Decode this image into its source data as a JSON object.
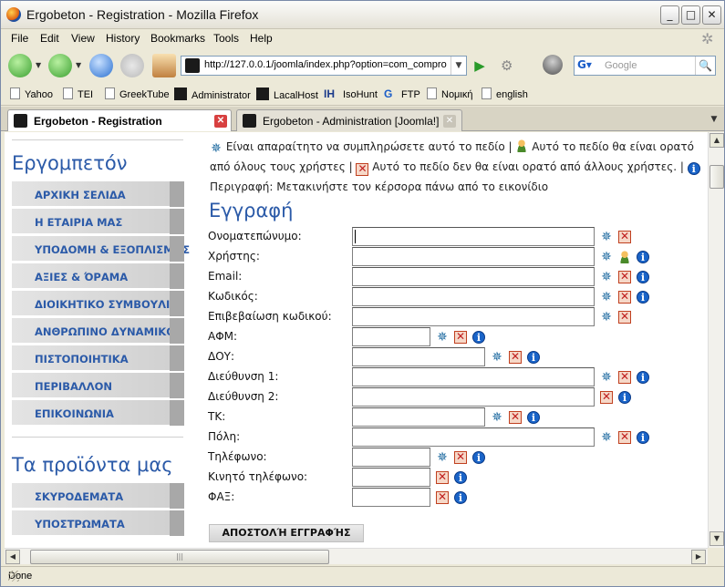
{
  "window": {
    "title": "Ergobeton - Registration - Mozilla Firefox",
    "buttons": {
      "minimize": "_",
      "maximize": "□",
      "close": "✕"
    }
  },
  "menu": [
    "File",
    "Edit",
    "View",
    "History",
    "Bookmarks",
    "Tools",
    "Help"
  ],
  "nav": {
    "url": "http://127.0.0.1/joomla/index.php?option=com_compro",
    "search_placeholder": "Google"
  },
  "bookmarks": [
    "Yahoo",
    "TEI",
    "GreekTube",
    "Administrator",
    "LacalHost",
    "IsoHunt",
    "FTP",
    "Νομική",
    "english"
  ],
  "tabs": [
    {
      "label": "Ergobeton - Registration",
      "active": true
    },
    {
      "label": "Ergobeton - Administration [Joomla!]",
      "active": false
    }
  ],
  "sidebar": {
    "heading1": "Εργομπετόν",
    "items": [
      "ΑΡΧΙΚΗ ΣΕΛΙΔΑ",
      "Η ΕΤΑΙΡΙΑ ΜΑΣ",
      "ΥΠΟΔΟΜΗ & ΕΞΟΠΛΙΣΜΟΣ",
      "ΑΞΙΕΣ & ΌΡΑΜΑ",
      "ΔΙΟΙΚΗΤΙΚΟ ΣΥΜΒΟΥΛΙΟ",
      "ΑΝΘΡΩΠΙΝΟ ΔΥΝΑΜΙΚΟ",
      "ΠΙΣΤΟΠΟΙΗΤΙΚΑ",
      "ΠΕΡΙΒΑΛΛΟΝ",
      "ΕΠΙΚΟΙΝΩΝΙΑ"
    ],
    "heading2": "Τα προϊόντα μας",
    "items2": [
      "ΣΚΥΡΟΔΕΜΑΤΑ",
      "ΥΠΟΣΤΡΩΜΑΤΑ"
    ]
  },
  "legend": {
    "required": "Είναι απαραίτητο να συμπληρώσετε αυτό το πεδίο",
    "visible": "Αυτό το πεδίο θα είναι ορατό από όλους τους χρήστες",
    "hidden": "Αυτό το πεδίο δεν θα είναι ορατό από άλλους χρήστες.",
    "description": "Περιγραφή: Μετακινήστε τον κέρσορα πάνω από το εικονίδιο",
    "sep": "|"
  },
  "form": {
    "title": "Εγγραφή",
    "fields": [
      {
        "label": "Ονοματεπώνυμο:",
        "size": "long",
        "icons": [
          "req",
          "hid"
        ]
      },
      {
        "label": "Χρήστης:",
        "size": "long",
        "icons": [
          "req",
          "vis",
          "info"
        ]
      },
      {
        "label": "Email:",
        "size": "long",
        "icons": [
          "req",
          "hid",
          "info"
        ]
      },
      {
        "label": "Κωδικός:",
        "size": "long",
        "icons": [
          "req",
          "hid",
          "info"
        ]
      },
      {
        "label": "Επιβεβαίωση κωδικού:",
        "size": "long",
        "icons": [
          "req",
          "hid"
        ]
      },
      {
        "label": "ΑΦΜ:",
        "size": "short",
        "icons": [
          "req",
          "hid",
          "info"
        ]
      },
      {
        "label": "ΔΟΥ:",
        "size": "medium",
        "icons": [
          "req",
          "hid",
          "info"
        ]
      },
      {
        "label": "Διεύθυνση 1:",
        "size": "long",
        "icons": [
          "req",
          "hid",
          "info"
        ]
      },
      {
        "label": "Διεύθυνση 2:",
        "size": "long",
        "icons": [
          "hid",
          "info"
        ]
      },
      {
        "label": "ΤΚ:",
        "size": "medium",
        "icons": [
          "req",
          "hid",
          "info"
        ]
      },
      {
        "label": "Πόλη:",
        "size": "long",
        "icons": [
          "req",
          "hid",
          "info"
        ]
      },
      {
        "label": "Τηλέφωνο:",
        "size": "short",
        "icons": [
          "req",
          "hid",
          "info"
        ]
      },
      {
        "label": "Κινητό τηλέφωνο:",
        "size": "short",
        "icons": [
          "hid",
          "info"
        ]
      },
      {
        "label": "ΦΑΞ:",
        "size": "short",
        "icons": [
          "hid",
          "info"
        ]
      }
    ],
    "submit": "ΑΠΟΣΤΟΛΉ ΕΓΓΡΑΦΉΣ"
  },
  "status": "Done"
}
